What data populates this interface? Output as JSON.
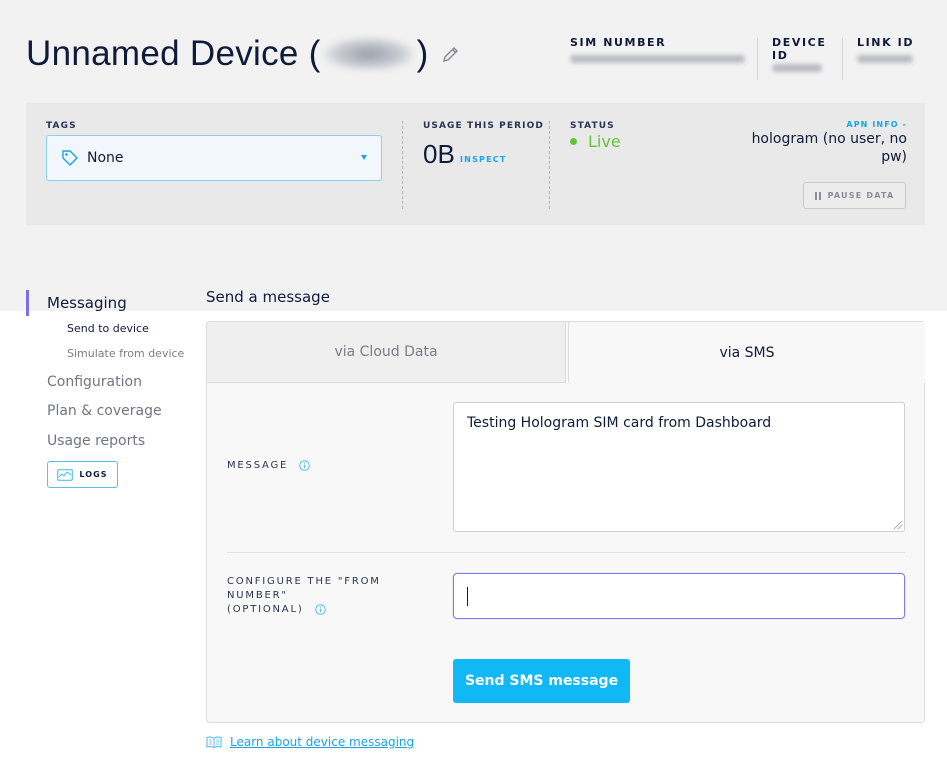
{
  "header": {
    "title_prefix": "Unnamed Device (",
    "title_suffix": ")",
    "sim_number_label": "SIM NUMBER",
    "device_id_label": "DEVICE ID",
    "link_id_label": "LINK ID"
  },
  "info": {
    "tags_label": "TAGS",
    "tags_value": "None",
    "usage_label": "USAGE THIS PERIOD",
    "usage_value": "0B",
    "inspect_label": "INSPECT",
    "status_label": "STATUS",
    "status_value": "Live",
    "apn_link": "APN INFO -",
    "apn_value": "hologram (no user, no pw)",
    "pause_label": "PAUSE DATA"
  },
  "sidebar": {
    "active": "Messaging",
    "sub_items": [
      "Send to device",
      "Simulate from device"
    ],
    "items": [
      "Configuration",
      "Plan & coverage",
      "Usage reports"
    ],
    "logs_label": "LOGS"
  },
  "main": {
    "section_title": "Send a message",
    "tabs": [
      "via Cloud Data",
      "via SMS"
    ],
    "active_tab": "via SMS",
    "message_label": "MESSAGE",
    "message_value": "Testing Hologram SIM card from Dashboard",
    "from_label_line1": "CONFIGURE THE \"FROM",
    "from_label_line2": "NUMBER\"",
    "from_label_line3": "(OPTIONAL)",
    "from_value": "",
    "send_label": "Send SMS message",
    "learn_link": "Learn about device messaging"
  },
  "colors": {
    "accent": "#10b8f5",
    "live": "#62c338",
    "active_nav": "#7a6ef0"
  }
}
